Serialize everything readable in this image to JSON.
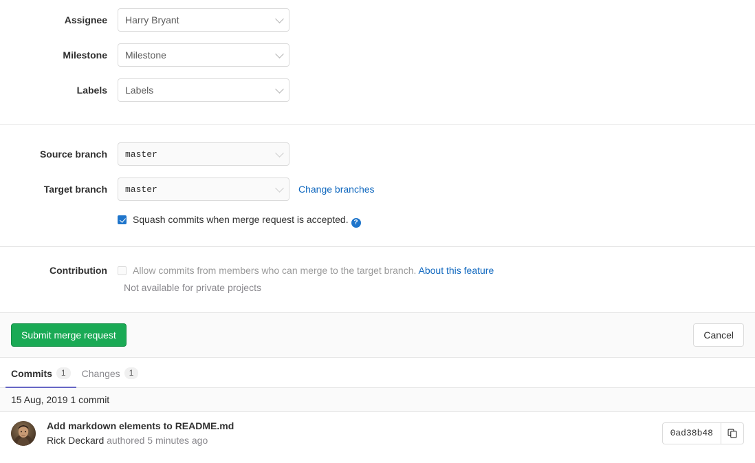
{
  "form": {
    "fields": [
      {
        "label": "Assignee",
        "value": "Harry Bryant",
        "disabled": false
      },
      {
        "label": "Milestone",
        "value": "Milestone",
        "disabled": false
      },
      {
        "label": "Labels",
        "value": "Labels",
        "disabled": false
      }
    ],
    "branches": [
      {
        "label": "Source branch",
        "value": "master"
      },
      {
        "label": "Target branch",
        "value": "master"
      }
    ],
    "change_branches_link": "Change branches",
    "squash": {
      "label": "Squash commits when merge request is accepted.",
      "checked": true,
      "help_icon": "help-icon"
    },
    "contribution": {
      "label": "Contribution",
      "checkbox_label": "Allow commits from members who can merge to the target branch.",
      "link": "About this feature",
      "note": "Not available for private projects",
      "checked": false
    }
  },
  "actions": {
    "submit_label": "Submit merge request",
    "cancel_label": "Cancel"
  },
  "tabs": [
    {
      "label": "Commits",
      "count": "1",
      "active": true
    },
    {
      "label": "Changes",
      "count": "1",
      "active": false
    }
  ],
  "commits": {
    "date_header": "15 Aug, 2019 1 commit",
    "items": [
      {
        "title": "Add markdown elements to README.md",
        "author": "Rick Deckard",
        "meta": "authored 5 minutes ago",
        "sha": "0ad38b48",
        "copy_icon": "copy-icon",
        "avatar": "user-avatar"
      }
    ]
  },
  "colors": {
    "green": "#1aaa55",
    "blue": "#1f75cb",
    "link": "#1068bf",
    "tab_active": "#6666c4"
  }
}
